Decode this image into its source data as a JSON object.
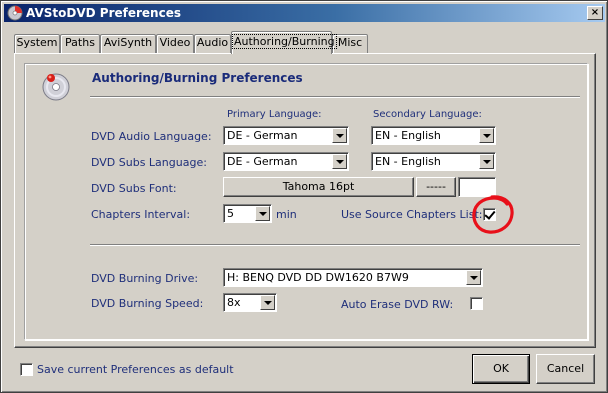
{
  "window": {
    "title": "AVStoDVD Preferences",
    "close_glyph": "×"
  },
  "tabs": [
    {
      "label": "System"
    },
    {
      "label": "Paths"
    },
    {
      "label": "AviSynth"
    },
    {
      "label": "Video"
    },
    {
      "label": "Audio"
    },
    {
      "label": "Authoring/Burning",
      "active": true
    },
    {
      "label": "Misc"
    }
  ],
  "section": {
    "title": "Authoring/Burning Preferences",
    "icon": "dvd-disc-icon"
  },
  "languages": {
    "primary_header": "Primary Language:",
    "secondary_header": "Secondary Language:",
    "audio_label": "DVD Audio Language:",
    "audio_primary": "DE - German",
    "audio_secondary": "EN - English",
    "subs_label": "DVD Subs Language:",
    "subs_primary": "DE - German",
    "subs_secondary": "EN - English"
  },
  "font": {
    "label": "DVD Subs Font:",
    "button": "Tahoma 16pt",
    "extra_button": "-----"
  },
  "chapters": {
    "label": "Chapters Interval:",
    "value": "5",
    "unit": "min",
    "source_label": "Use Source Chapters List:",
    "source_checked": true
  },
  "burning": {
    "drive_label": "DVD Burning Drive:",
    "drive_value": "H: BENQ DVD DD DW1620 B7W9",
    "speed_label": "DVD Burning Speed:",
    "speed_value": "8x",
    "auto_erase_label": "Auto Erase DVD RW:",
    "auto_erase_checked": false
  },
  "footer": {
    "save_default_label": "Save current Preferences as default",
    "save_default_checked": false,
    "ok_label": "OK",
    "cancel_label": "Cancel"
  },
  "colors": {
    "annotation_circle": "#e8101a",
    "title_bar": "#0a246a",
    "label_text": "#1f2f7a"
  }
}
